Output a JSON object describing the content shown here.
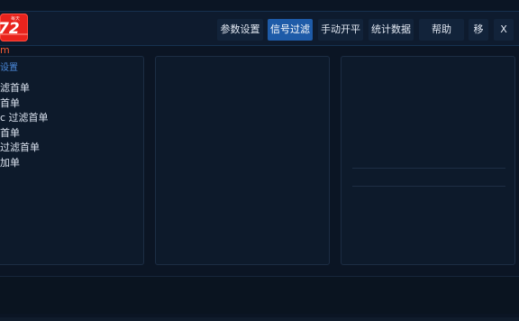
{
  "logo": {
    "badge_text": "每天",
    "mark_text": "72",
    "icon": "app-logo-icon"
  },
  "title": "m",
  "nav": {
    "items": [
      {
        "label": "参数设置",
        "active": false
      },
      {
        "label": "信号过滤",
        "active": true
      },
      {
        "label": "手动开平",
        "active": false
      },
      {
        "label": "统计数据",
        "active": false
      },
      {
        "label": "帮助",
        "active": false
      },
      {
        "label": "移",
        "active": false
      },
      {
        "label": "X",
        "active": false
      }
    ]
  },
  "left_panel": {
    "heading": "设置",
    "items": [
      {
        "label": "滤首单"
      },
      {
        "label": "首单"
      },
      {
        "label": "c 过滤首单"
      },
      {
        "label": "首单"
      },
      {
        "label": "过滤首单"
      },
      {
        "label": "加单"
      }
    ]
  },
  "colors": {
    "background": "#0b1524",
    "header": "#0e1b2e",
    "accent": "#1e5ba8",
    "title": "#f45a32",
    "heading": "#4a88d8",
    "logo": "#e8231d"
  }
}
